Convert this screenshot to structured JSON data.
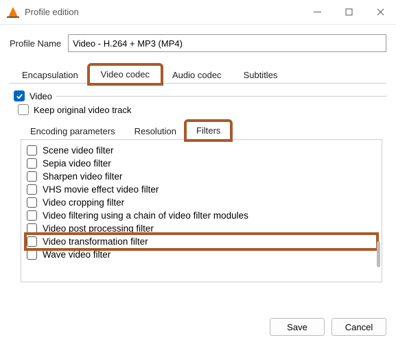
{
  "window": {
    "title": "Profile edition"
  },
  "profile": {
    "label": "Profile Name",
    "value": "Video - H.264 + MP3 (MP4)"
  },
  "mainTabs": {
    "encapsulation": "Encapsulation",
    "videoCodec": "Video codec",
    "audioCodec": "Audio codec",
    "subtitles": "Subtitles"
  },
  "videoSection": {
    "videoLabel": "Video",
    "keepOriginal": "Keep original video track"
  },
  "subTabs": {
    "encoding": "Encoding parameters",
    "resolution": "Resolution",
    "filters": "Filters"
  },
  "filters": [
    "Scene video filter",
    "Sepia video filter",
    "Sharpen video filter",
    "VHS movie effect video filter",
    "Video cropping filter",
    "Video filtering using a chain of video filter modules",
    "Video post processing filter",
    "Video transformation filter",
    "Wave video filter"
  ],
  "buttons": {
    "save": "Save",
    "cancel": "Cancel"
  }
}
